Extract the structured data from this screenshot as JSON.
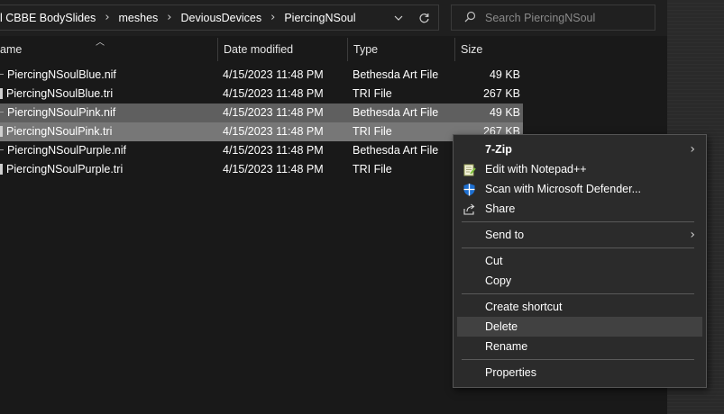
{
  "address": {
    "crumbs": [
      "l CBBE BodySlides",
      "meshes",
      "DeviousDevices",
      "PiercingNSoul"
    ],
    "search_placeholder": "Search PiercingNSoul"
  },
  "columns": {
    "name": "ame",
    "date": "Date modified",
    "type": "Type",
    "size": "Size"
  },
  "files": [
    {
      "name": "PiercingNSoulBlue.nif",
      "date": "4/15/2023 11:48 PM",
      "type": "Bethesda Art File",
      "size": "49 KB",
      "kind": "nif",
      "selected": false
    },
    {
      "name": "PiercingNSoulBlue.tri",
      "date": "4/15/2023 11:48 PM",
      "type": "TRI File",
      "size": "267 KB",
      "kind": "tri",
      "selected": false
    },
    {
      "name": "PiercingNSoulPink.nif",
      "date": "4/15/2023 11:48 PM",
      "type": "Bethesda Art File",
      "size": "49 KB",
      "kind": "nif",
      "selected": true
    },
    {
      "name": "PiercingNSoulPink.tri",
      "date": "4/15/2023 11:48 PM",
      "type": "TRI File",
      "size": "267 KB",
      "kind": "tri",
      "selected": true
    },
    {
      "name": "PiercingNSoulPurple.nif",
      "date": "4/15/2023 11:48 PM",
      "type": "Bethesda Art File",
      "size": "",
      "kind": "nif",
      "selected": false
    },
    {
      "name": "PiercingNSoulPurple.tri",
      "date": "4/15/2023 11:48 PM",
      "type": "TRI File",
      "size": "",
      "kind": "tri",
      "selected": false
    }
  ],
  "context_menu": {
    "seven_zip": "7-Zip",
    "edit_notepad": "Edit with Notepad++",
    "scan_defender": "Scan with Microsoft Defender...",
    "share": "Share",
    "send_to": "Send to",
    "cut": "Cut",
    "copy": "Copy",
    "create_shortcut": "Create shortcut",
    "delete": "Delete",
    "rename": "Rename",
    "properties": "Properties"
  },
  "colors": {
    "background": "#191919",
    "selection": "#5f5f5f",
    "menu_bg": "#2b2b2b",
    "menu_hover": "#414141",
    "defender_blue": "#1d6fd1"
  }
}
